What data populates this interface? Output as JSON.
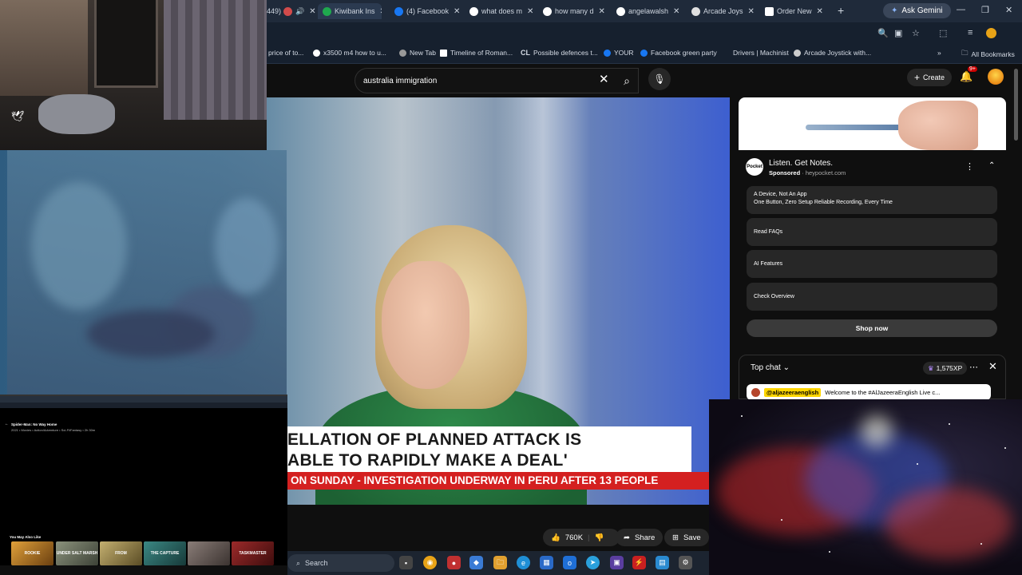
{
  "browser": {
    "tabs": [
      {
        "label": "449)",
        "color": "#d24b4b"
      },
      {
        "label": "Kiwibank Ins",
        "color": "#1fa84e"
      },
      {
        "label": "(4) Facebook",
        "color": "#1877f2"
      },
      {
        "label": "what does m",
        "color": "#ffffff"
      },
      {
        "label": "how many d",
        "color": "#ffffff"
      },
      {
        "label": "angelawalsh",
        "color": "#ffffff"
      },
      {
        "label": "Arcade Joys",
        "color": "#e0e0e0"
      },
      {
        "label": "Order New",
        "color": "#ffffff"
      }
    ],
    "new_tab": "+",
    "ask_gemini": "Ask Gemini",
    "bookmarks": [
      {
        "label": "price of to..."
      },
      {
        "label": "x3500 m4 how to u..."
      },
      {
        "label": "New Tab"
      },
      {
        "label": "Timeline of Roman..."
      },
      {
        "label": "Possible defences t..."
      },
      {
        "label": "YOUR"
      },
      {
        "label": "Facebook green party"
      },
      {
        "label": "Drivers | Machinist"
      },
      {
        "label": "Arcade Joystick with..."
      },
      {
        "label": "All Bookmarks"
      }
    ]
  },
  "youtube": {
    "search_value": "australia immigration",
    "create_label": "Create",
    "notification_count": "9+"
  },
  "video": {
    "lower_third_line1": "ELLATION OF PLANNED ATTACK IS",
    "lower_third_line2": "ABLE TO RAPIDLY MAKE A DEAL'",
    "ticker": "ON SUNDAY   -   INVESTIGATION UNDERWAY IN PERU AFTER 13 PEOPLE",
    "likes": "760K",
    "share_label": "Share",
    "save_label": "Save"
  },
  "ad": {
    "title": "Listen. Get Notes.",
    "sponsored_label": "Sponsored",
    "domain": "heypocket.com",
    "logo_text": "Pocket",
    "card1_line1": "A Device, Not An App",
    "card1_line2": "One Button, Zero Setup Reliable Recording, Every Time",
    "card2": "Read FAQs",
    "card3": "AI Features",
    "card4": "Check Overview",
    "shop_now": "Shop now"
  },
  "chat": {
    "title": "Top chat",
    "xp": "1,575XP",
    "pinned_handle": "@aljazeeraenglish",
    "pinned_text": "Welcome to the #AlJazeeraEnglish Live c..."
  },
  "mini_screen": {
    "title": "Spider-Man: No Way Home",
    "meta": "2021 • Movies • Action/Adventure • Sci-Fi/Fantasy • 2h 30m",
    "you_may_also_like": "You May Also Like",
    "thumbs": [
      {
        "label": "ROOKIE",
        "color": "#c4862a"
      },
      {
        "label": "UNDER SALT MARSH",
        "color": "#6e7560"
      },
      {
        "label": "FROM",
        "color": "#9c8a4e"
      },
      {
        "label": "THE CAPTURE",
        "color": "#2b6a68"
      },
      {
        "label": "",
        "color": "#6a5e5a"
      },
      {
        "label": "TASKMASTER",
        "color": "#7a1f1f"
      }
    ]
  },
  "taskbar": {
    "search_label": "Search"
  }
}
